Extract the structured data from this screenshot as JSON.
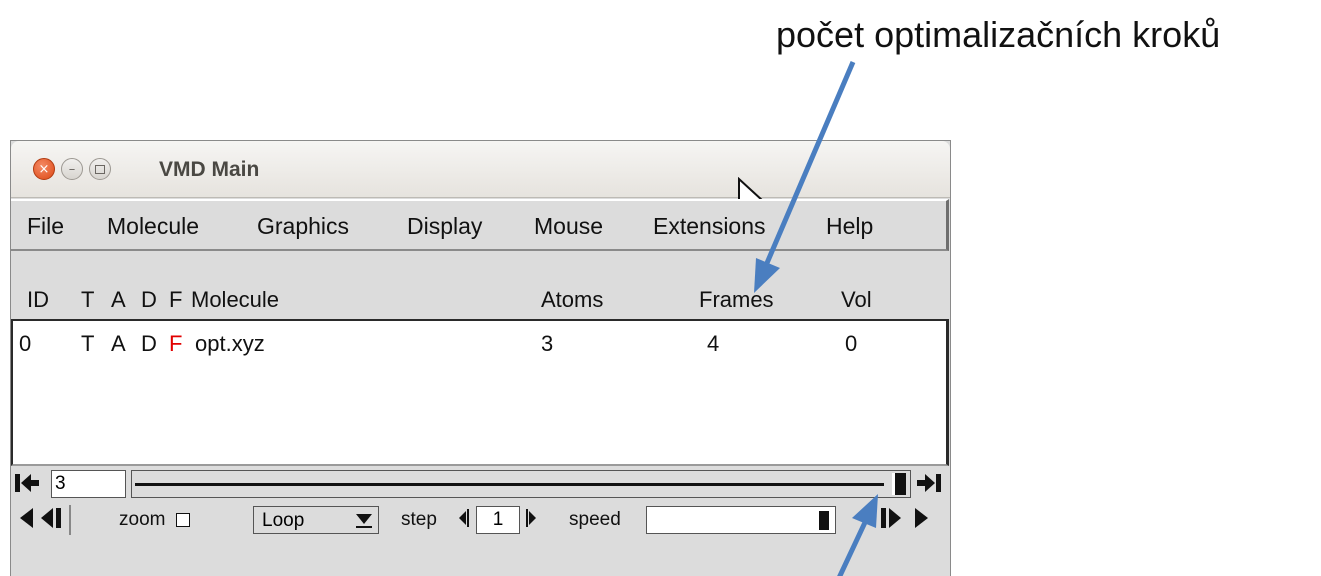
{
  "annotation": {
    "top_label": "počet optimalizačních kroků"
  },
  "window": {
    "title": "VMD Main",
    "menu": [
      "File",
      "Molecule",
      "Graphics",
      "Display",
      "Mouse",
      "Extensions",
      "Help"
    ]
  },
  "molecule_list": {
    "columns": [
      "ID",
      "T",
      "A",
      "D",
      "F",
      "Molecule",
      "Atoms",
      "Frames",
      "Vol"
    ],
    "rows": [
      {
        "id": "0",
        "t": "T",
        "a": "A",
        "d": "D",
        "f": "F",
        "name": "opt.xyz",
        "atoms": "3",
        "frames": "4",
        "vol": "0"
      }
    ]
  },
  "animation": {
    "current_frame": "3",
    "zoom_label": "zoom",
    "zoom_checked": false,
    "loop_mode": "Loop",
    "step_label": "step",
    "step_value": "1",
    "speed_label": "speed"
  },
  "colors": {
    "arrow": "#4a7ec0",
    "frozen_flag": "#e10000",
    "close_button": "#dd4814"
  }
}
